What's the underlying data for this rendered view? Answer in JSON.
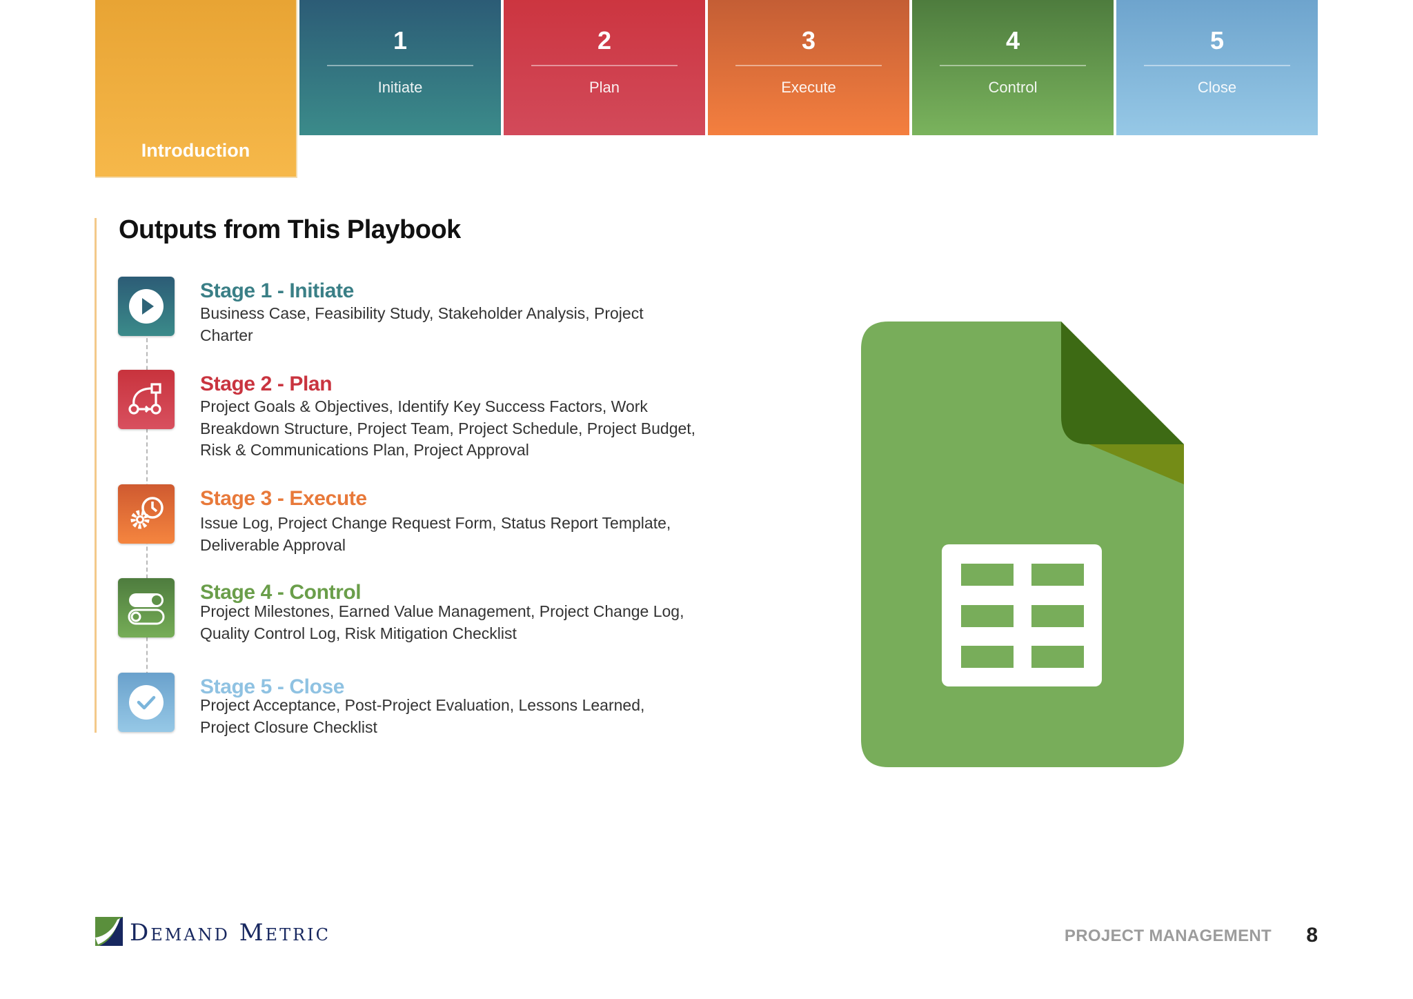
{
  "nav": {
    "intro_label": "Introduction",
    "tabs": [
      {
        "number": "1",
        "label": "Initiate"
      },
      {
        "number": "2",
        "label": "Plan"
      },
      {
        "number": "3",
        "label": "Execute"
      },
      {
        "number": "4",
        "label": "Control"
      },
      {
        "number": "5",
        "label": "Close"
      }
    ]
  },
  "section": {
    "title": "Outputs from This Playbook",
    "stages": [
      {
        "title": "Stage 1 - Initiate",
        "color": "#3a7f86",
        "icon": "play-icon",
        "description": "Business Case, Feasibility Study, Stakeholder Analysis, Project Charter"
      },
      {
        "title": "Stage 2 - Plan",
        "color": "#c9343f",
        "icon": "workflow-icon",
        "description": "Project Goals & Objectives, Identify Key Success Factors, Work Breakdown Structure, Project Team, Project Schedule, Project Budget, Risk & Communications Plan, Project Approval"
      },
      {
        "title": "Stage 3 - Execute",
        "color": "#e8793a",
        "icon": "gear-clock-icon",
        "description": "Issue Log, Project Change Request Form, Status Report Template, Deliverable Approval"
      },
      {
        "title": "Stage 4 - Control",
        "color": "#6a9e4a",
        "icon": "toggle-icon",
        "description": "Project Milestones, Earned Value Management, Project Change Log, Quality Control Log, Risk Mitigation Checklist"
      },
      {
        "title": "Stage 5 - Close",
        "color": "#8fc2e2",
        "icon": "checkmark-icon",
        "description": "Project Acceptance, Post-Project Evaluation, Lessons Learned, Project Closure Checklist"
      }
    ]
  },
  "graphic": {
    "icon": "spreadsheet-file-icon",
    "color": "#78ad5a"
  },
  "footer": {
    "brand": "Demand Metric",
    "label": "PROJECT MANAGEMENT",
    "page": "8"
  }
}
